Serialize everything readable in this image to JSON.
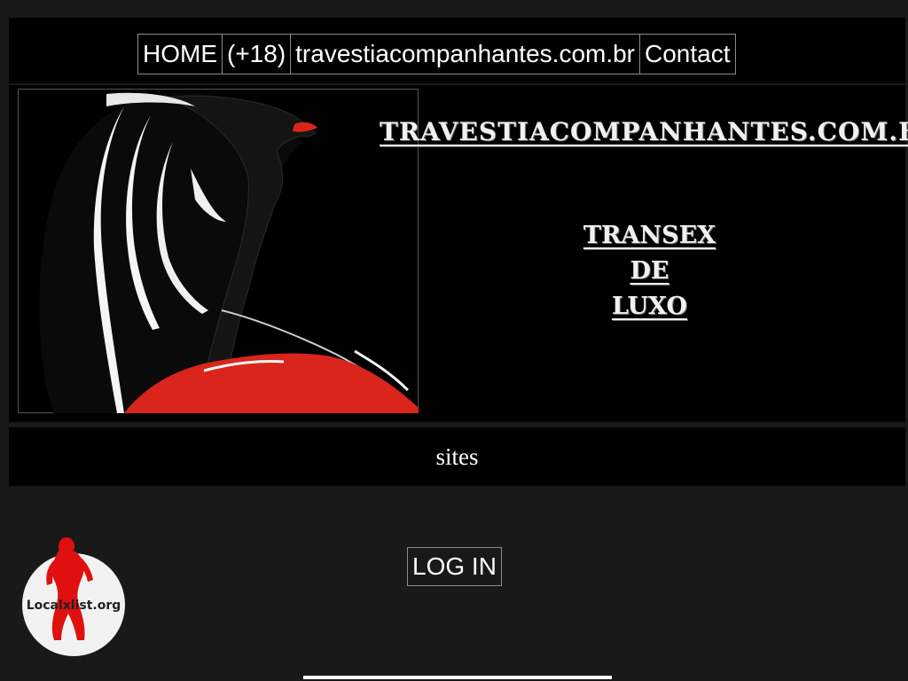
{
  "nav": {
    "items": [
      {
        "label": "HOME"
      },
      {
        "label": "(+18)"
      },
      {
        "label": "travestiacompanhantes.com.br"
      },
      {
        "label": "Contact"
      }
    ]
  },
  "banner": {
    "title": "TRAVESTIACOMPANHANTES.COM.BR",
    "tagline": [
      "TRANSEX",
      "DE",
      "LUXO"
    ]
  },
  "sites": {
    "label": "sites"
  },
  "login": {
    "label": "LOG IN"
  },
  "logo": {
    "text": "Localxlist.org"
  },
  "colors": {
    "page_bg": "#191919",
    "panel_bg": "#000000",
    "accent_red": "#d9251b",
    "text": "#ffffff"
  }
}
